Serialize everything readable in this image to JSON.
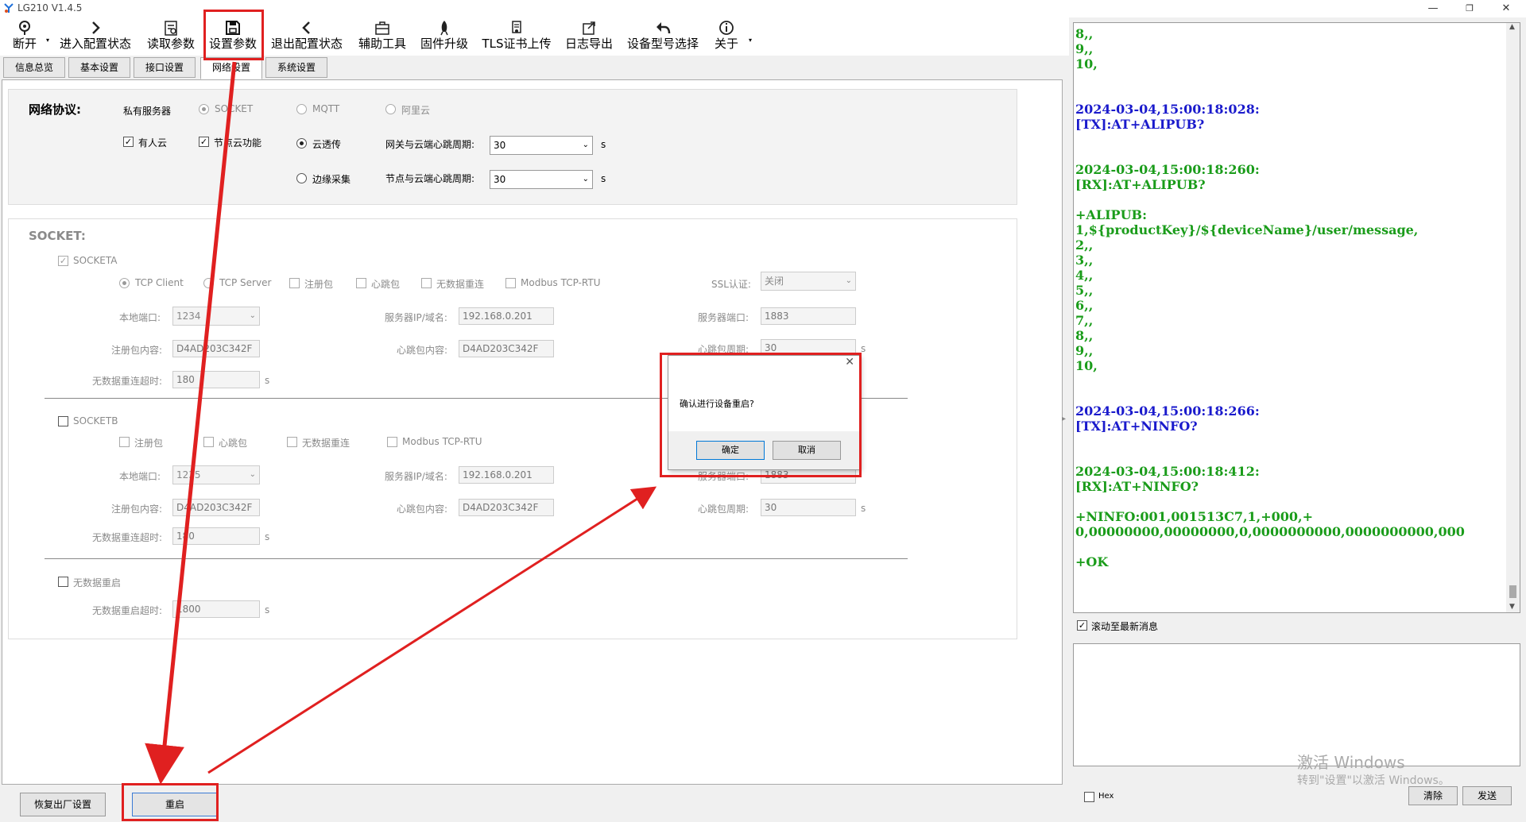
{
  "window": {
    "title": "LG210 V1.4.5",
    "minimize": "—",
    "restore": "❐",
    "close": "✕"
  },
  "toolbar": {
    "disconnect": "断开",
    "enter_config": "进入配置状态",
    "read_params": "读取参数",
    "set_params": "设置参数",
    "exit_config": "退出配置状态",
    "aux_tools": "辅助工具",
    "firmware_upgrade": "固件升级",
    "tls_upload": "TLS证书上传",
    "log_export": "日志导出",
    "model_select": "设备型号选择",
    "about": "关于"
  },
  "tabs": [
    "信息总览",
    "基本设置",
    "接口设置",
    "网络设置",
    "系统设置"
  ],
  "network": {
    "protocol_label": "网络协议:",
    "private_server": "私有服务器",
    "socket": "SOCKET",
    "mqtt": "MQTT",
    "aliyun": "阿里云",
    "youren_cloud": "有人云",
    "node_cloud": "节点云功能",
    "cloud_transparent": "云透传",
    "edge_collect": "边缘采集",
    "gw_heartbeat_label": "网关与云端心跳周期:",
    "gw_heartbeat_value": "30",
    "node_heartbeat_label": "节点与云端心跳周期:",
    "node_heartbeat_value": "30",
    "unit_s": "s"
  },
  "socket": {
    "title": "SOCKET:",
    "socketa": "SOCKETA",
    "tcp_client": "TCP Client",
    "tcp_server": "TCP Server",
    "reg_packet": "注册包",
    "heartbeat_packet": "心跳包",
    "no_data_reconnect": "无数据重连",
    "modbus": "Modbus TCP-RTU",
    "ssl_label": "SSL认证:",
    "ssl_value": "关闭",
    "local_port_label": "本地端口:",
    "a_local_port": "1234",
    "server_ip_label": "服务器IP/域名:",
    "a_server_ip": "192.168.0.201",
    "server_port_label": "服务器端口:",
    "a_server_port": "1883",
    "reg_content_label": "注册包内容:",
    "a_reg_content": "D4AD203C342F",
    "hb_content_label": "心跳包内容:",
    "a_hb_content": "D4AD203C342F",
    "hb_period_label": "心跳包周期:",
    "a_hb_period": "30",
    "timeout_label": "无数据重连超时:",
    "a_timeout": "180",
    "socketb": "SOCKETB",
    "b_local_port": "1235",
    "b_server_ip": "192.168.0.201",
    "b_server_port": "1883",
    "b_reg_content": "D4AD203C342F",
    "b_hb_content": "D4AD203C342F",
    "b_hb_period": "30",
    "b_timeout": "180",
    "no_data_restart": "无数据重启",
    "restart_timeout_label": "无数据重启超时:",
    "restart_timeout": "1800"
  },
  "bottom": {
    "factory_reset": "恢复出厂设置",
    "restart": "重启"
  },
  "dialog": {
    "message": "确认进行设备重启?",
    "ok": "确定",
    "cancel": "取消",
    "close": "✕"
  },
  "log": [
    {
      "t": "rx",
      "text": "8,,"
    },
    {
      "t": "rx",
      "text": "9,,"
    },
    {
      "t": "rx",
      "text": "10,"
    },
    {
      "t": "rx",
      "text": ""
    },
    {
      "t": "rx",
      "text": ""
    },
    {
      "t": "tx",
      "text": "2024-03-04,15:00:18:028:"
    },
    {
      "t": "tx",
      "text": "[TX]:AT+ALIPUB?"
    },
    {
      "t": "rx",
      "text": ""
    },
    {
      "t": "rx",
      "text": ""
    },
    {
      "t": "rx",
      "text": "2024-03-04,15:00:18:260:"
    },
    {
      "t": "rx",
      "text": "[RX]:AT+ALIPUB?"
    },
    {
      "t": "rx",
      "text": ""
    },
    {
      "t": "rx",
      "text": "+ALIPUB:"
    },
    {
      "t": "rx",
      "text": "1,${productKey}/${deviceName}/user/message,"
    },
    {
      "t": "rx",
      "text": "2,,"
    },
    {
      "t": "rx",
      "text": "3,,"
    },
    {
      "t": "rx",
      "text": "4,,"
    },
    {
      "t": "rx",
      "text": "5,,"
    },
    {
      "t": "rx",
      "text": "6,,"
    },
    {
      "t": "rx",
      "text": "7,,"
    },
    {
      "t": "rx",
      "text": "8,,"
    },
    {
      "t": "rx",
      "text": "9,,"
    },
    {
      "t": "rx",
      "text": "10,"
    },
    {
      "t": "rx",
      "text": ""
    },
    {
      "t": "rx",
      "text": ""
    },
    {
      "t": "tx",
      "text": "2024-03-04,15:00:18:266:"
    },
    {
      "t": "tx",
      "text": "[TX]:AT+NINFO?"
    },
    {
      "t": "rx",
      "text": ""
    },
    {
      "t": "rx",
      "text": ""
    },
    {
      "t": "rx",
      "text": "2024-03-04,15:00:18:412:"
    },
    {
      "t": "rx",
      "text": "[RX]:AT+NINFO?"
    },
    {
      "t": "rx",
      "text": ""
    },
    {
      "t": "rx",
      "text": "+NINFO:001,001513C7,1,+000,+"
    },
    {
      "t": "rx",
      "text": "0,00000000,00000000,0,0000000000,0000000000,000"
    },
    {
      "t": "rx",
      "text": ""
    },
    {
      "t": "rx",
      "text": "+OK"
    }
  ],
  "right": {
    "scroll_latest": "滚动至最新消息",
    "hex": "Hex",
    "clear": "清除",
    "send": "发送"
  },
  "watermark": {
    "line1": "激活 Windows",
    "line2": "转到\"设置\"以激活 Windows。"
  },
  "colors": {
    "tx": "#1a1acc",
    "rx": "#1a9c1a",
    "annotation_red": "#e02020"
  }
}
